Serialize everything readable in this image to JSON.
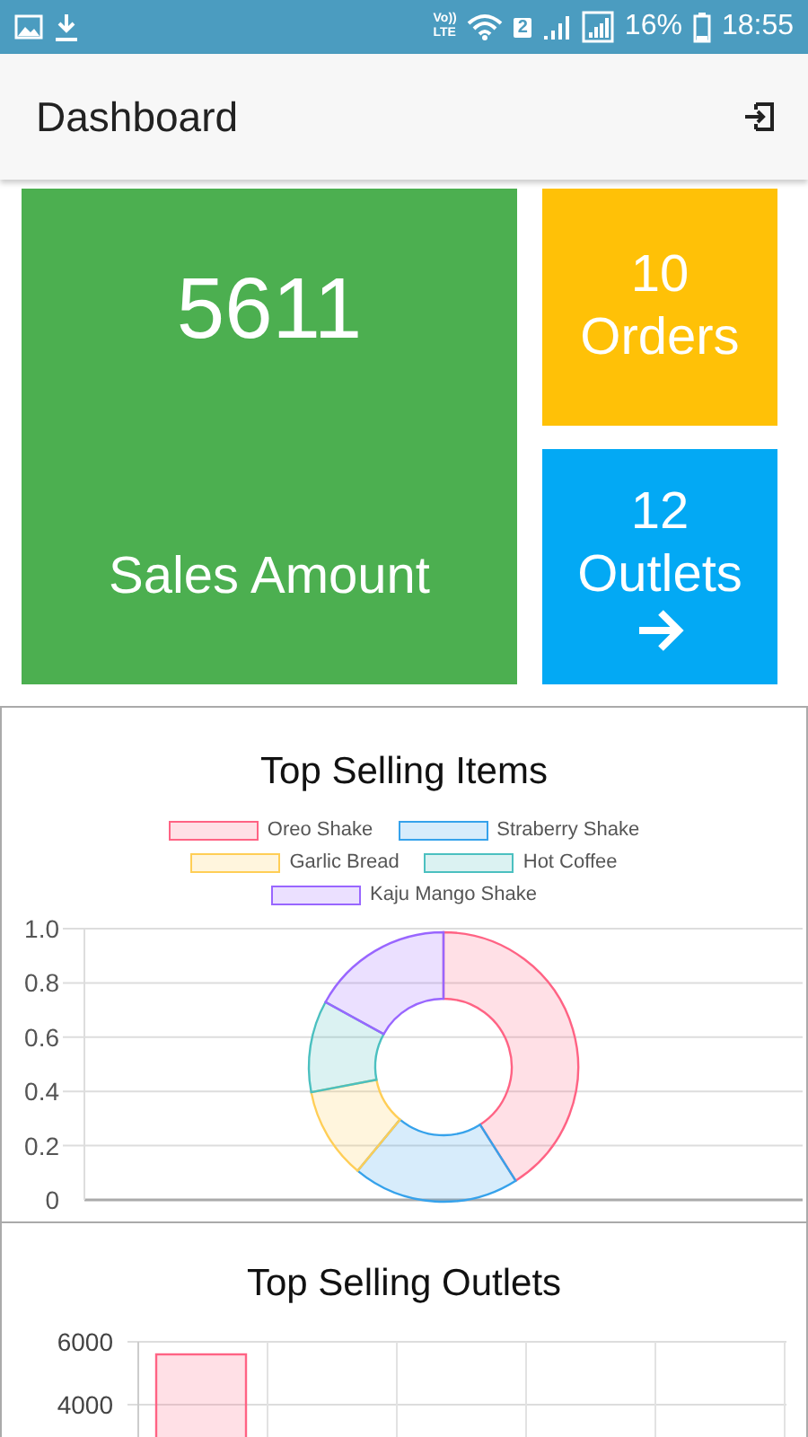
{
  "status_bar": {
    "volte_top": "Vo))",
    "volte_bottom": "LTE",
    "sim": "2",
    "battery": "16%",
    "time": "18:55"
  },
  "app_bar": {
    "title": "Dashboard"
  },
  "tiles": [
    {
      "kind": "big",
      "value": "5611",
      "label": "Sales Amount",
      "color": "#4caf50"
    },
    {
      "kind": "small",
      "value": "10",
      "label": "Orders",
      "color": "#ffc107"
    },
    {
      "kind": "arrow",
      "value": "12",
      "label": "Outlets",
      "color": "#03a9f4"
    }
  ],
  "charts": [
    {
      "title": "Top Selling Items",
      "axis_labels": [
        "1.0",
        "0.8",
        "0.6",
        "0.4",
        "0.2",
        "0"
      ],
      "chart_data": {
        "type": "donut",
        "categories": [
          "Oreo Shake",
          "Straberry Shake",
          "Garlic Bread",
          "Hot Coffee",
          "Kaju Mango Shake"
        ],
        "values": [
          0.41,
          0.2,
          0.11,
          0.11,
          0.17
        ],
        "colors": [
          "#ff6384",
          "#36a2eb",
          "#ffce56",
          "#4bc0c0",
          "#9966ff"
        ]
      }
    },
    {
      "title": "Top Selling Outlets",
      "chart_data": {
        "type": "bar",
        "values": [
          5600
        ],
        "colors": [
          "#ff6384"
        ],
        "ylim": [
          0,
          6000
        ],
        "yticks": [
          4000,
          6000
        ]
      }
    }
  ]
}
